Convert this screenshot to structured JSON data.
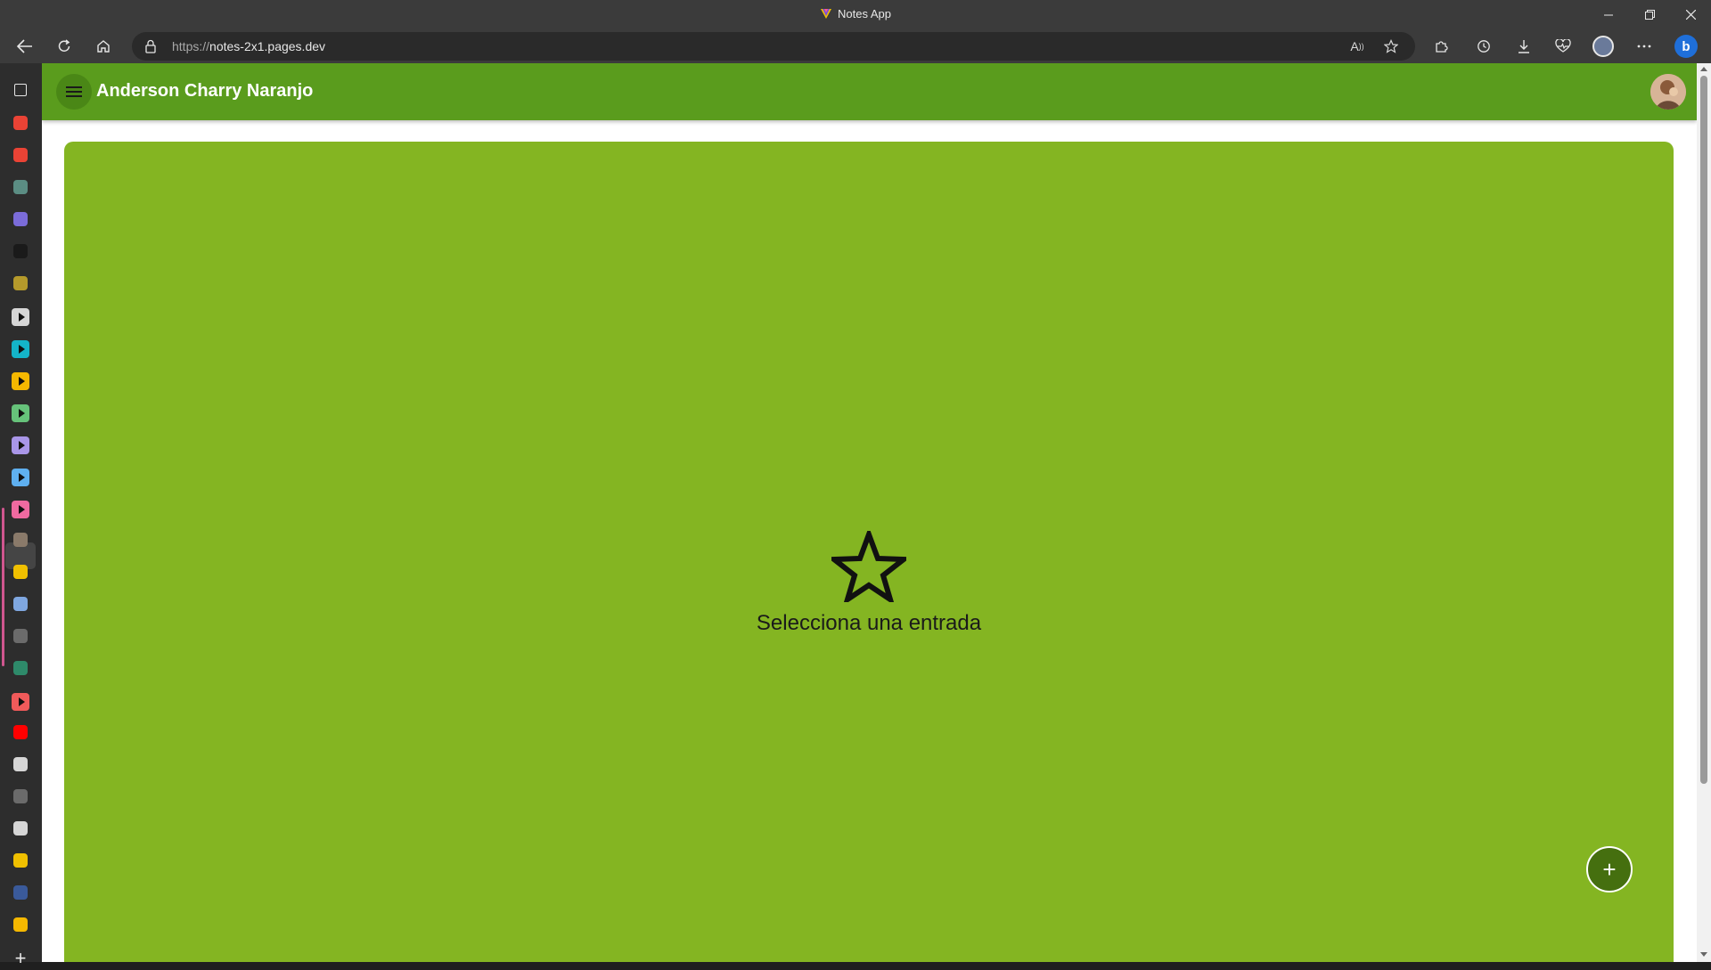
{
  "window": {
    "title": "Notes App",
    "controls": [
      "minimize",
      "restore",
      "close"
    ]
  },
  "browser": {
    "url_protocol": "https://",
    "url_host": "notes-2x1.pages.dev",
    "toolbar_icons": [
      "back-icon",
      "refresh-icon",
      "home-icon",
      "read-aloud-icon",
      "favorite-star-icon",
      "extensions-icon",
      "history-icon",
      "downloads-icon",
      "browser-essentials-icon",
      "profile-icon",
      "more-icon",
      "bing-copilot-icon"
    ],
    "read_aloud_label": "A"
  },
  "sidebar_tabs": {
    "items": [
      {
        "name": "tab-actions-icon",
        "color": "#e6e6e6"
      },
      {
        "name": "gmail-icon",
        "color": "#ea4335"
      },
      {
        "name": "gmail-icon",
        "color": "#ea4335"
      },
      {
        "name": "app-icon",
        "color": "#5b8d83"
      },
      {
        "name": "sparkle-icon",
        "color": "#7b6cd9"
      },
      {
        "name": "p-icon",
        "color": "#1a1a1a"
      },
      {
        "name": "partial-icon",
        "color": "#b59a2b"
      },
      {
        "name": "player-icon",
        "color": "#d6d6d6"
      },
      {
        "name": "player-icon",
        "color": "#14b4c8"
      },
      {
        "name": "player-icon",
        "color": "#f5b800"
      },
      {
        "name": "player-icon",
        "color": "#66c27a"
      },
      {
        "name": "player-icon",
        "color": "#a996e8"
      },
      {
        "name": "player-icon",
        "color": "#5fb0f0"
      },
      {
        "name": "player-icon",
        "color": "#ef6aa0"
      },
      {
        "name": "cloud-icon",
        "color": "#8a7a6a"
      },
      {
        "name": "notes-app-icon",
        "color": "#f0c000"
      },
      {
        "name": "doc-icon",
        "color": "#7fa7e0"
      },
      {
        "name": "image-icon",
        "color": "#6b6b6b"
      },
      {
        "name": "square-icon",
        "color": "#2e8a6a"
      },
      {
        "name": "player-icon",
        "color": "#f05a5a"
      },
      {
        "name": "youtube-icon",
        "color": "#ff0000"
      },
      {
        "name": "speaker-icon",
        "color": "#d6d6d6"
      },
      {
        "name": "image-icon",
        "color": "#6b6b6b"
      },
      {
        "name": "github-icon",
        "color": "#d6d6d6"
      },
      {
        "name": "notes-app-icon",
        "color": "#f0c000"
      },
      {
        "name": "search-icon",
        "color": "#3a5a9a"
      },
      {
        "name": "hand-icon",
        "color": "#f5b800"
      },
      {
        "name": "new-tab-icon",
        "color": "#e6e6e6"
      }
    ]
  },
  "app": {
    "user_name": "Anderson Charry Naranjo",
    "empty_message": "Selecciona una entrada",
    "fab_label": "+",
    "colors": {
      "appbar": "#5a9c1d",
      "panel": "#84b522",
      "fab": "#456f0f"
    }
  }
}
